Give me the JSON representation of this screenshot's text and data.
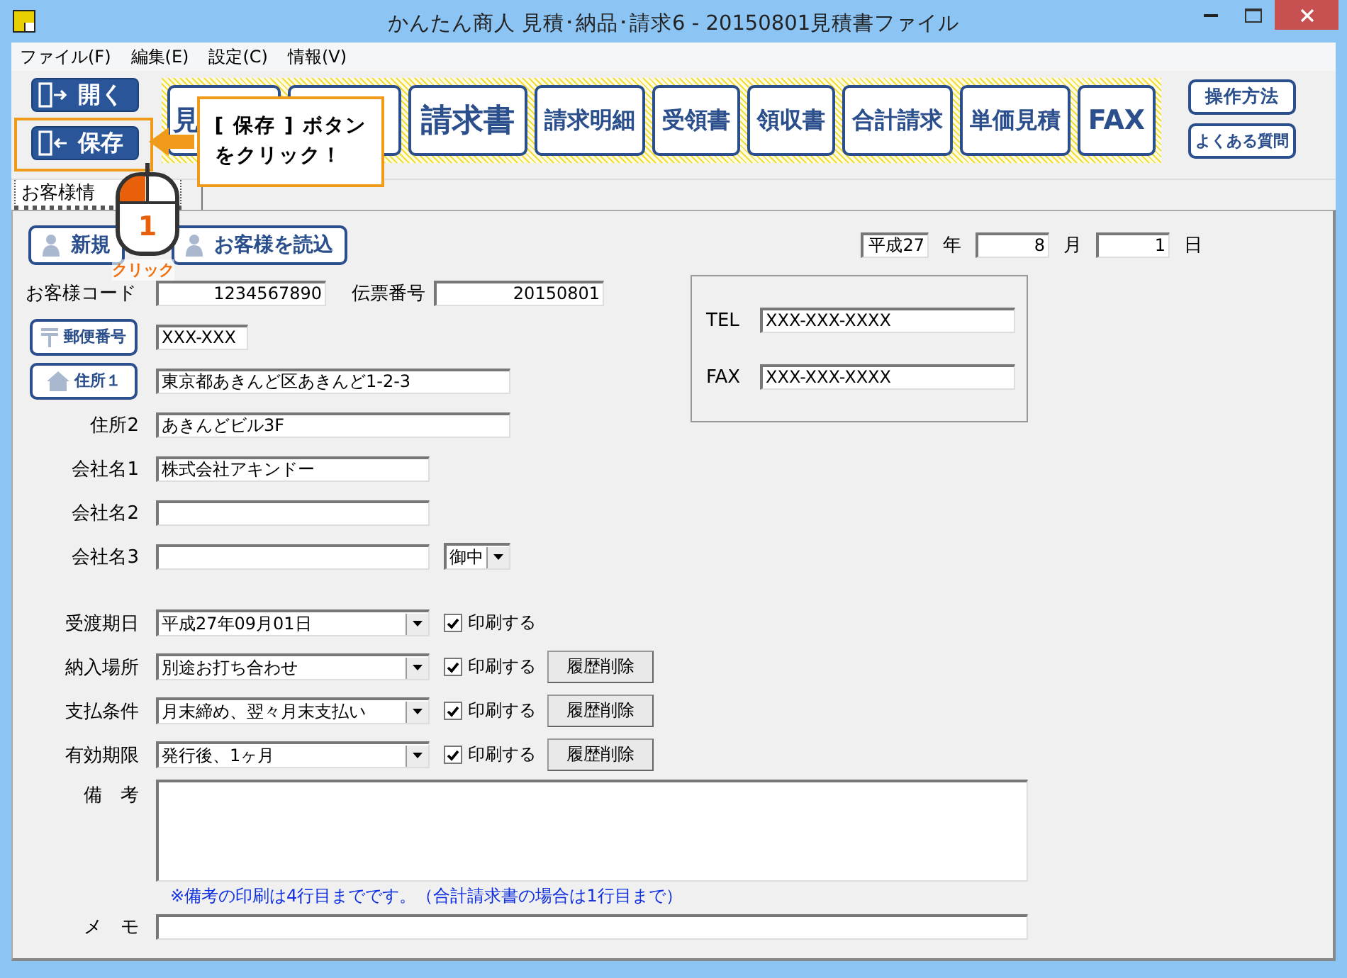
{
  "window": {
    "title": "かんたん商人 見積･納品･請求6 - 20150801見積書ファイル"
  },
  "menu": [
    "ファイル(F)",
    "編集(E)",
    "設定(C)",
    "情報(V)"
  ],
  "file_buttons": [
    {
      "label": "開く",
      "kind": "open",
      "highlighted": false
    },
    {
      "label": "保存",
      "kind": "save",
      "highlighted": true
    }
  ],
  "document_buttons": [
    {
      "kind": "labeled",
      "label": "見"
    },
    {
      "kind": "covered"
    },
    {
      "kind": "labeled",
      "label": "請求書"
    },
    {
      "kind": "labeled",
      "label": "請求明細"
    },
    {
      "kind": "labeled",
      "label": "受領書"
    },
    {
      "kind": "labeled",
      "label": "領収書"
    },
    {
      "kind": "labeled",
      "label": "合計請求"
    },
    {
      "kind": "labeled",
      "label": "単価見積"
    },
    {
      "kind": "labeled",
      "label": "FAX"
    }
  ],
  "help_buttons": [
    "操作方法",
    "よくある質問"
  ],
  "callout": {
    "lines": [
      "[ 保存 ] ボタン",
      "をクリック！"
    ],
    "step": "1",
    "caption": "クリック"
  },
  "tabs": [
    {
      "label": "お客様情",
      "selected": true
    }
  ],
  "customer_buttons": [
    "新規",
    "お客様を読込"
  ],
  "date": {
    "era_year": "平成27",
    "year_label": "年",
    "month": "8",
    "month_label": "月",
    "day": "1",
    "day_label": "日"
  },
  "customer_code": {
    "label": "お客様コード",
    "value": "1234567890"
  },
  "slip_number": {
    "label": "伝票番号",
    "value": "20150801"
  },
  "postal": {
    "button": "郵便番号",
    "value": "XXX-XXX"
  },
  "address1": {
    "button": "住所１",
    "value": "東京都あきんど区あきんど1-2-3"
  },
  "address2": {
    "label": "住所2",
    "value": "あきんどビル3F"
  },
  "company1": {
    "label": "会社名1",
    "value": "株式会社アキンドー"
  },
  "company2": {
    "label": "会社名2"
  },
  "company3": {
    "label": "会社名3",
    "honorific": "御中"
  },
  "phone": [
    {
      "label": "TEL",
      "value": "XXX-XXX-XXXX"
    },
    {
      "label": "FAX",
      "value": "XXX-XXX-XXXX"
    }
  ],
  "conditions": [
    {
      "label": "受渡期日",
      "value": "平成27年09月01日",
      "print_label": "印刷する",
      "print": true
    },
    {
      "label": "納入場所",
      "value": "別途お打ち合わせ",
      "print_label": "印刷する",
      "print": true,
      "clear_button": "履歴削除"
    },
    {
      "label": "支払条件",
      "value": "月末締め、翌々月末支払い",
      "print_label": "印刷する",
      "print": true,
      "clear_button": "履歴削除"
    },
    {
      "label": "有効期限",
      "value": "発行後、1ヶ月",
      "print_label": "印刷する",
      "print": true,
      "clear_button": "履歴削除"
    }
  ],
  "remarks": {
    "label": "備　考",
    "note": "※備考の印刷は4行目までです。（合計請求書の場合は1行目まで）"
  },
  "memo": {
    "label": "メ　モ"
  }
}
